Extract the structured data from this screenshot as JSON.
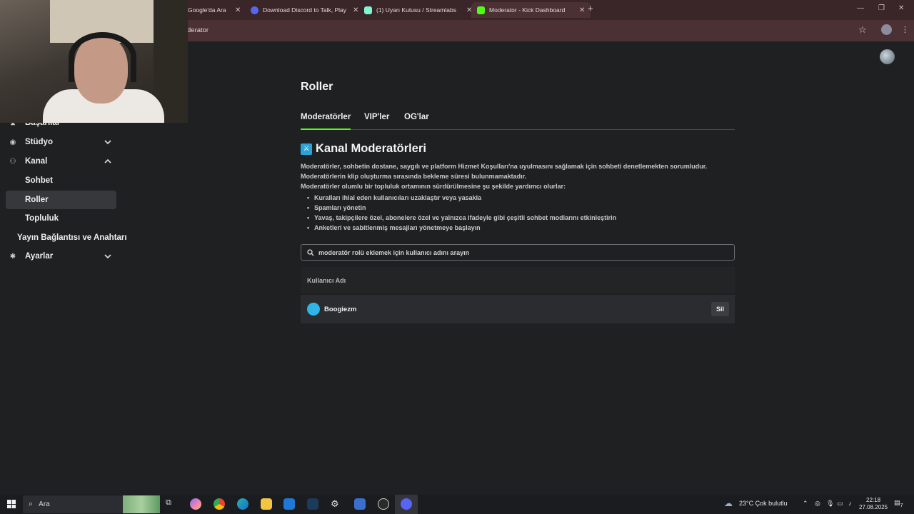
{
  "browser": {
    "tabs": [
      {
        "title": "Google'da Ara",
        "favicon_color": "#ffffff"
      },
      {
        "title": "Download Discord to Talk, Play",
        "favicon_color": "#5865f2"
      },
      {
        "title": "(1) Uyarı Kutusu / Streamlabs",
        "favicon_color": "#80f5d2"
      },
      {
        "title": "Moderator - Kick Dashboard",
        "favicon_color": "#53fc18"
      }
    ],
    "url_fragment": "derator"
  },
  "sidebar": {
    "items": [
      {
        "label": "Başarılar",
        "icon": "trophy-icon"
      },
      {
        "label": "Stüdyo",
        "icon": "studio-icon"
      },
      {
        "label": "Kanal",
        "icon": "channel-icon"
      },
      {
        "label": "Yayın Bağlantısı ve Anahtarı",
        "icon": ""
      },
      {
        "label": "Ayarlar",
        "icon": "gear-icon"
      }
    ],
    "subitems": [
      {
        "label": "Sohbet"
      },
      {
        "label": "Roller"
      },
      {
        "label": "Topluluk"
      }
    ]
  },
  "main": {
    "title": "Roller",
    "tabs": [
      "Moderatörler",
      "VIP'ler",
      "OG'lar"
    ],
    "section_title": "Kanal Moderatörleri",
    "description": [
      "Moderatörler, sohbetin dostane, saygılı ve platform Hizmet Koşulları'na uyulmasını sağlamak için sohbeti denetlemekten sorumludur.",
      "Moderatörlerin klip oluşturma sırasında bekleme süresi bulunmamaktadır.",
      "Moderatörler olumlu bir topluluk ortamının sürdürülmesine şu şekilde yardımcı olurlar:"
    ],
    "bullets": [
      "Kuralları ihlal eden kullanıcıları uzaklaştır veya yasakla",
      "Spamları yönetin",
      "Yavaş, takipçilere özel, abonelere özel ve yalnızca ifadeyle gibi çeşitli sohbet modlarını etkinleştirin",
      "Anketleri ve sabitlenmiş mesajları yönetmeye başlayın"
    ],
    "search_placeholder": "moderatör rolü eklemek için kullanıcı adını arayın",
    "table": {
      "header": "Kullanıcı Adı",
      "rows": [
        {
          "username": "Boogiezm",
          "action": "Sil"
        }
      ]
    }
  },
  "taskbar": {
    "search_label": "Ara",
    "weather": "23°C  Çok bulutlu",
    "time": "22:18",
    "date": "27.08.2025",
    "notif_count": "7"
  },
  "colors": {
    "accent": "#53fc18",
    "kick_blue": "#2aa4d8",
    "bg": "#1f2022"
  }
}
